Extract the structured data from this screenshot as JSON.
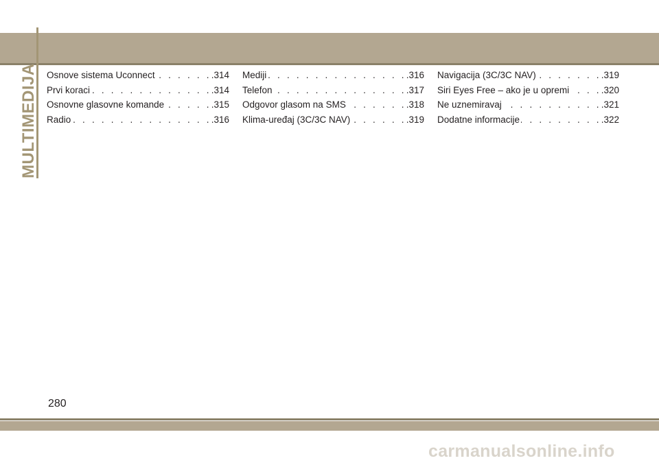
{
  "section": {
    "side_title": "MULTIMEDIJA"
  },
  "toc": {
    "columns": [
      [
        {
          "title": "Osnove sistema Uconnect",
          "page": ".314"
        },
        {
          "title": "Prvi koraci",
          "page": ".314"
        },
        {
          "title": "Osnovne glasovne komande",
          "page": ".315"
        },
        {
          "title": "Radio",
          "page": ".316"
        }
      ],
      [
        {
          "title": "Mediji",
          "page": ".316"
        },
        {
          "title": "Telefon",
          "page": ".317"
        },
        {
          "title": "Odgovor glasom na SMS",
          "page": ".318"
        },
        {
          "title": "Klima-uređaj (3C/3C NAV)",
          "page": ".319"
        }
      ],
      [
        {
          "title": "Navigacija (3C/3C NAV)",
          "page": ".319"
        },
        {
          "title": "Siri Eyes Free – ako je u opremi",
          "page": ".320"
        },
        {
          "title": "Ne uznemiravaj",
          "page": ".321"
        },
        {
          "title": "Dodatne informacije",
          "page": ".322"
        }
      ]
    ]
  },
  "footer": {
    "page_number": "280",
    "watermark": "carmanualsonline.info"
  },
  "colors": {
    "band": "#b3a791",
    "band_line": "#8a8168",
    "side_title": "#a39675"
  }
}
